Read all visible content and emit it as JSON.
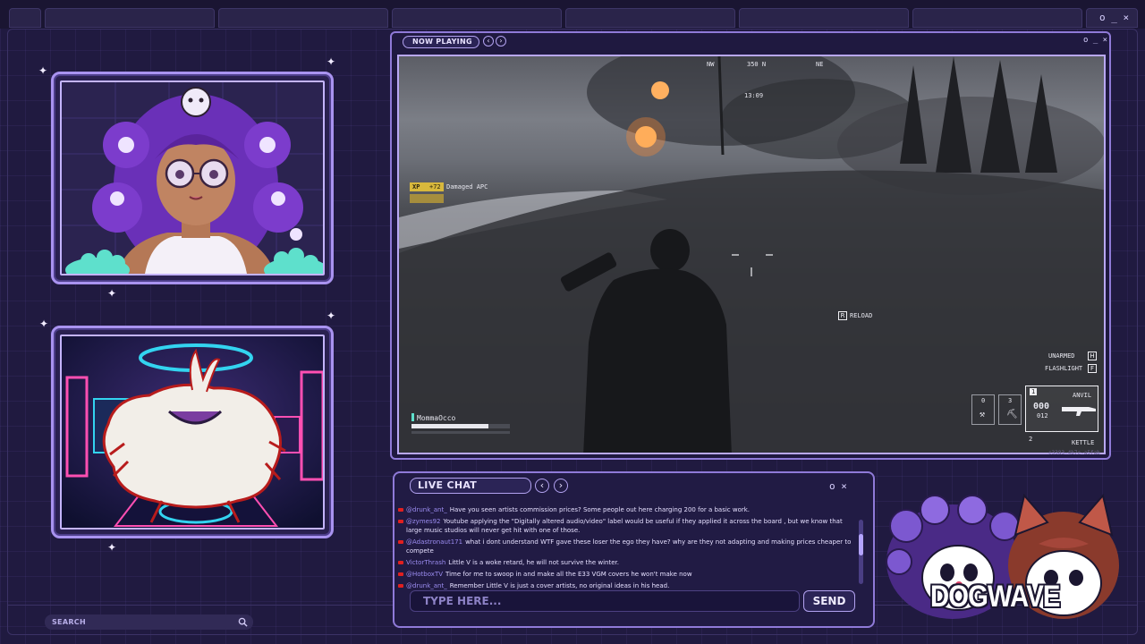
{
  "window": {
    "controls": "o _ ×"
  },
  "game_panel": {
    "now_playing_label": "NOW PLAYING",
    "controls": "o _ ×",
    "hud": {
      "compass_nw": "NW",
      "compass_heading": "350 N",
      "compass_ne": "NE",
      "timer": "13:09",
      "xp_1": "+72",
      "event_1": "Damaged APC",
      "reload_key": "R",
      "reload_label": "RELOAD",
      "unarmed_label": "UNARMED",
      "unarmed_key": "H",
      "flashlight_label": "FLASHLIGHT",
      "flashlight_key": "F",
      "player_name": "MommaOcco",
      "slot_0": "0",
      "slot_3": "3",
      "slot_1": "1",
      "weapon_1": "ANVIL",
      "ammo_count": "000",
      "ammo_reserve": "012",
      "slot_2": "2",
      "weapon_2": "KETTLE",
      "build_id": "c3383-4b7c-a5fab"
    }
  },
  "chat": {
    "title": "LIVE CHAT",
    "controls": "o ×",
    "messages": [
      {
        "user": "@drunk_ant_",
        "text": "Have you seen artists commission prices? Some people out here charging 200 for a basic work."
      },
      {
        "user": "@zymes92",
        "text": "Youtube applying the \"Digitally altered audio/video\" label would be useful if they applied it across the board , but we know that large music studios will never get hit with one of those."
      },
      {
        "user": "@Adastronaut171",
        "text": "what i dont understand WTF gave these loser the ego they have? why are they not adapting and making prices cheaper to compete"
      },
      {
        "user": "VictorThrash",
        "text": "Little V is a woke retard, he will not survive the winter."
      },
      {
        "user": "@HotboxTV",
        "text": "Time for me to swoop in and make all the E33 VGM covers he won't make now"
      },
      {
        "user": "@drunk_ant_",
        "text": "Remember Little V is just a cover artists, no original ideas in his head."
      }
    ],
    "input_placeholder": "TYPE HERE...",
    "send_label": "SEND"
  },
  "search": {
    "placeholder": "SEARCH"
  },
  "logo": {
    "text": "DOGWAVE"
  },
  "colors": {
    "background": "#201a40",
    "frame_accent": "#a993f0",
    "panel": "#211b44",
    "chat_username": "#9b8cf0",
    "youtube_red": "#e02020"
  }
}
